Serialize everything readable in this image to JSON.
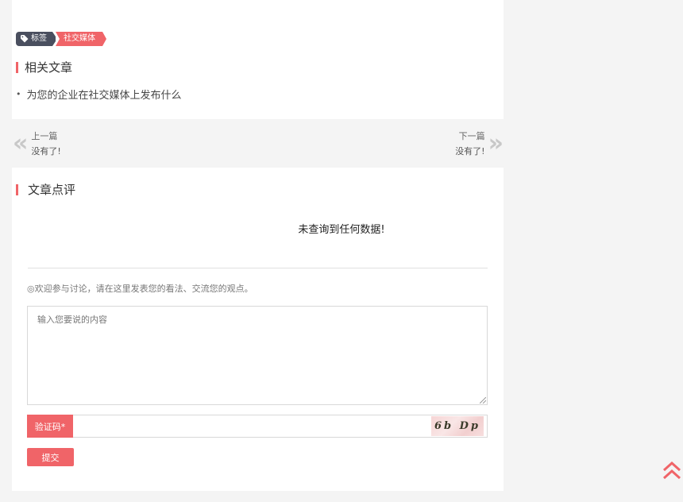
{
  "tags": {
    "label": "标签",
    "items": [
      "社交媒体"
    ]
  },
  "related": {
    "title": "相关文章",
    "items": [
      "为您的企业在社交媒体上发布什么"
    ]
  },
  "pager": {
    "prev_label": "上一篇",
    "prev_value": "没有了!",
    "next_label": "下一篇",
    "next_value": "没有了!"
  },
  "comments": {
    "title": "文章点评",
    "empty_message": "未查询到任何数据!",
    "hint": "◎欢迎参与讨论，请在这里发表您的看法、交流您的观点。",
    "textarea_placeholder": "输入您要说的内容",
    "captcha_label": "验证码*",
    "captcha_text": "6b Dp",
    "submit_label": "提交"
  },
  "colors": {
    "accent": "#f06468",
    "tag_dark": "#4a4f5f"
  },
  "icons": {
    "tag": "tag-icon",
    "prev": "double-chevron-left-icon",
    "next": "double-chevron-right-icon",
    "back_to_top": "double-chevron-up-icon"
  }
}
